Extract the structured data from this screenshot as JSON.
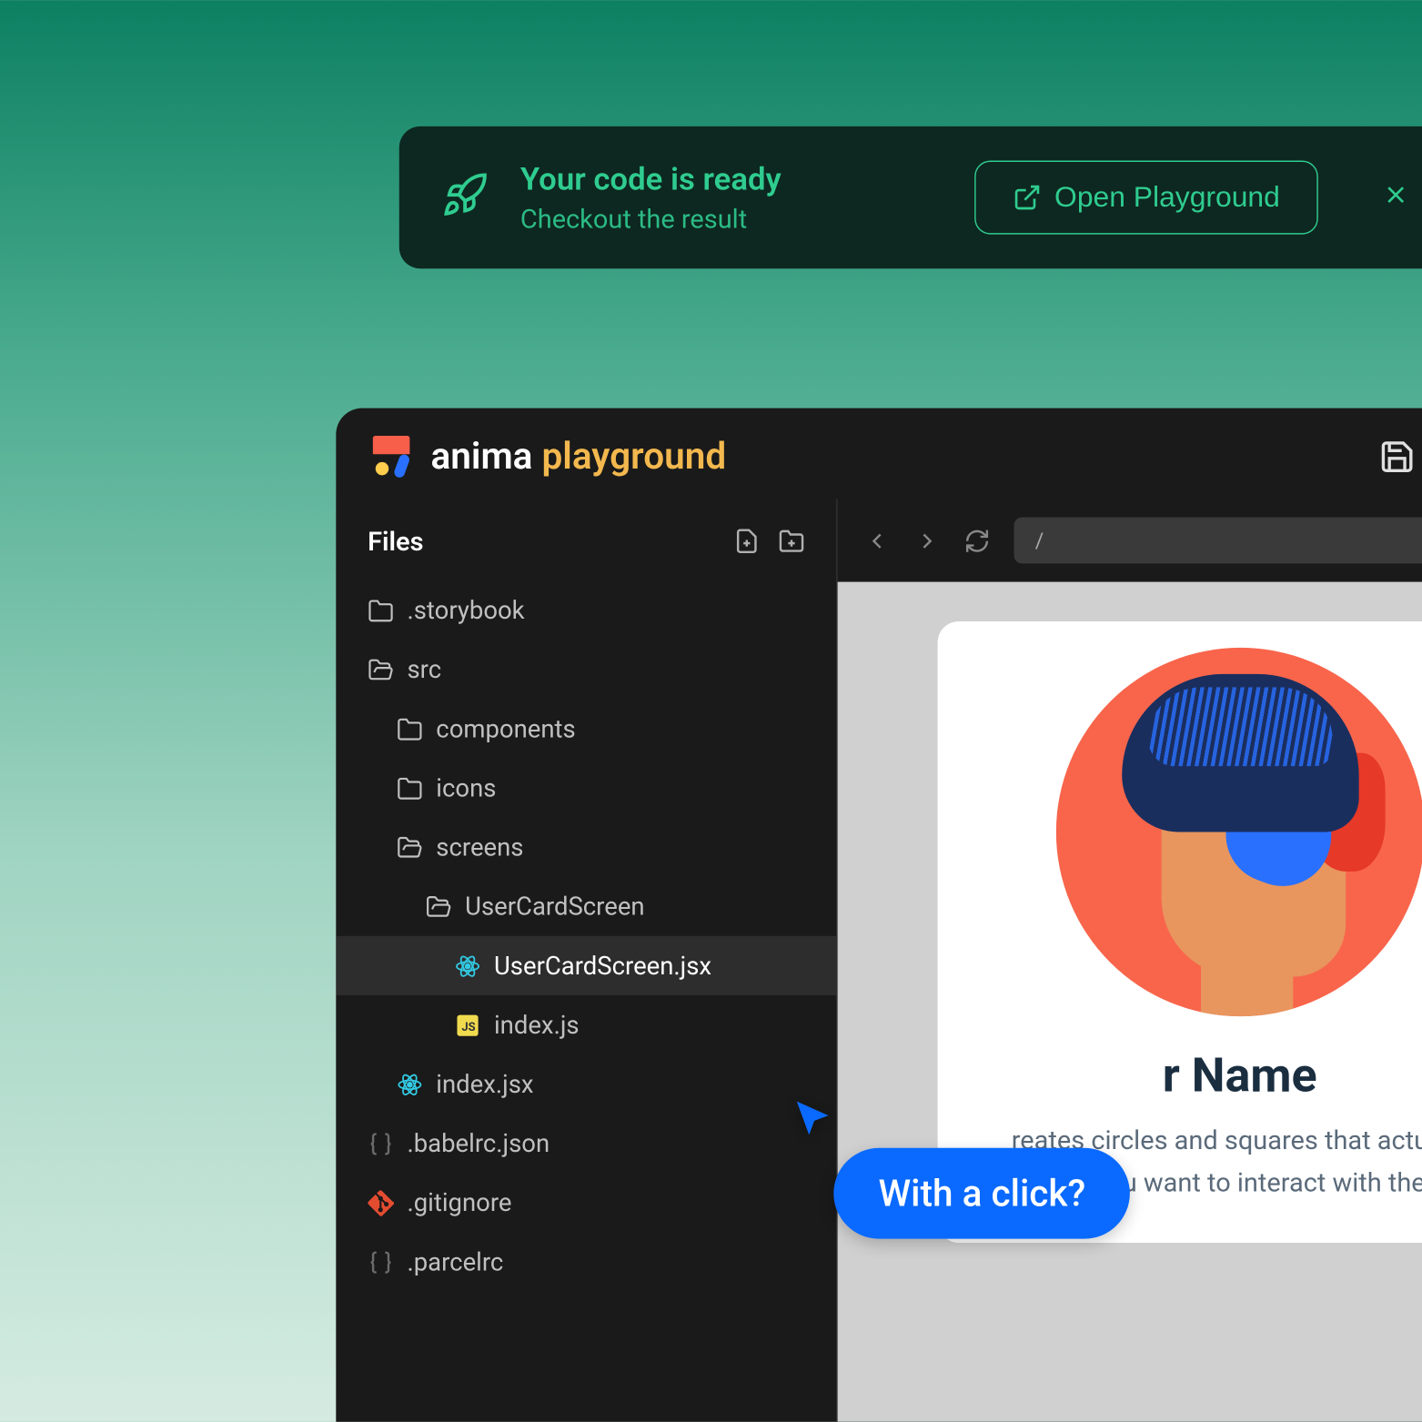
{
  "toast": {
    "title": "Your code is ready",
    "subtitle": "Checkout the result",
    "button_label": "Open Playground"
  },
  "brand": {
    "name": "anima",
    "accent": "playground"
  },
  "sidebar": {
    "title": "Files",
    "tree": [
      {
        "label": ".storybook",
        "icon": "folder"
      },
      {
        "label": "src",
        "icon": "folder-open"
      },
      {
        "label": "components",
        "icon": "folder"
      },
      {
        "label": "icons",
        "icon": "folder"
      },
      {
        "label": "screens",
        "icon": "folder-open"
      },
      {
        "label": "UserCardScreen",
        "icon": "folder-open"
      },
      {
        "label": "UserCardScreen.jsx",
        "icon": "react"
      },
      {
        "label": "index.js",
        "icon": "js"
      },
      {
        "label": "index.jsx",
        "icon": "react"
      },
      {
        "label": ".babelrc.json",
        "icon": "braces"
      },
      {
        "label": ".gitignore",
        "icon": "git"
      },
      {
        "label": ".parcelrc",
        "icon": "braces"
      }
    ]
  },
  "preview": {
    "url": "/",
    "card_title": "r Name",
    "card_desc": "reates circles and squares that actually make you want to interact with them."
  },
  "annotation": {
    "label": "With a click?"
  }
}
